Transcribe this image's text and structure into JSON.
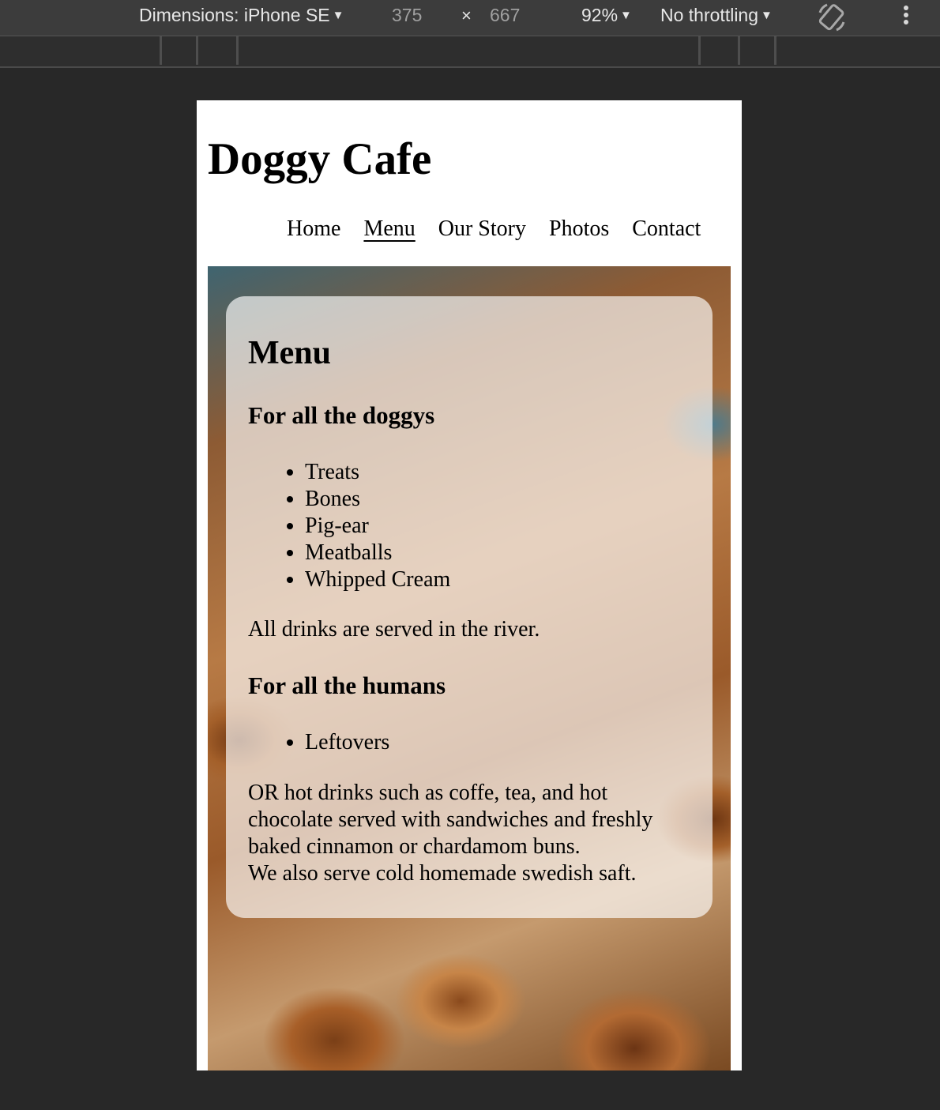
{
  "devtools": {
    "dimensions_label": "Dimensions: iPhone SE",
    "width": "375",
    "times": "×",
    "height": "667",
    "zoom": "92%",
    "throttling": "No throttling",
    "caret": "▼",
    "rotate_icon": "rotate-icon",
    "more_icon": "more-vertical-icon"
  },
  "site": {
    "title": "Doggy Cafe",
    "nav": [
      "Home",
      "Menu",
      "Our Story",
      "Photos",
      "Contact"
    ],
    "active_nav": "Menu"
  },
  "menu": {
    "heading": "Menu",
    "dogs": {
      "heading": "For all the doggys",
      "items": [
        "Treats",
        "Bones",
        "Pig-ear",
        "Meatballs",
        "Whipped Cream"
      ],
      "note": "All drinks are served in the river."
    },
    "humans": {
      "heading": "For all the humans",
      "items": [
        "Leftovers"
      ],
      "note_lines": [
        "OR hot drinks such as coffe, tea, and hot",
        "chocolate served with sandwiches and freshly",
        "baked cinnamon or chardamom buns.",
        "We also serve cold homemade swedish saft."
      ]
    }
  },
  "colors": {
    "devtools_bg": "#282828",
    "toolbar_bg": "#3c3c3c",
    "card_bg": "rgba(255,255,255,0.66)"
  }
}
